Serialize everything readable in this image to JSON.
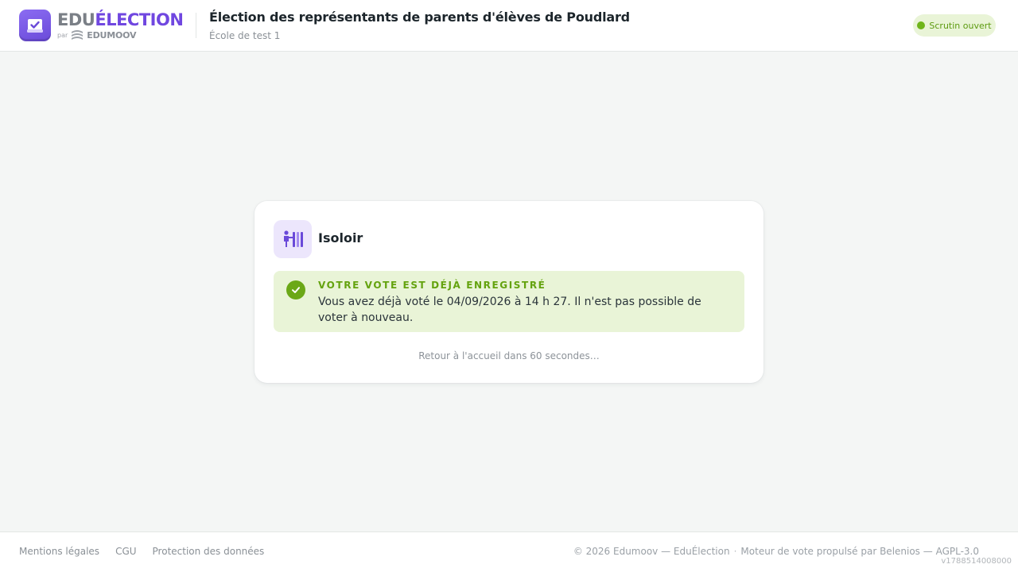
{
  "header": {
    "logo": {
      "wordmark_edu": "EDU",
      "wordmark_election": "ÉLECTION",
      "par": "par",
      "brand": "EDUMOOV"
    },
    "election_title": "Élection des représentants de parents d'élèves de Poudlard",
    "school_name": "École de test 1",
    "status": "Scrutin ouvert"
  },
  "card": {
    "title": "Isoloir",
    "icon": "voting-booth-icon",
    "alert": {
      "heading": "VOTRE VOTE EST DÉJÀ ENREGISTRÉ",
      "body": "Vous avez déjà voté le 04/09/2026 à 14 h 27. Il n'est pas possible de voter à nouveau.",
      "icon": "check-circle-icon"
    },
    "countdown": "Retour à l'accueil dans 60 secondes…"
  },
  "footer": {
    "links": [
      "Mentions légales",
      "CGU",
      "Protection des données"
    ],
    "copyright": "© 2026 Edumoov — EduÉlection",
    "separator": "·",
    "engine": "Moteur de vote propulsé par Belenios — AGPL-3.0",
    "version": "v1788514008000"
  },
  "colors": {
    "brand_purple": "#7047e0",
    "status_green": "#6fb51a",
    "alert_bg": "#e9f4d7",
    "page_bg": "#f4f6f5"
  }
}
